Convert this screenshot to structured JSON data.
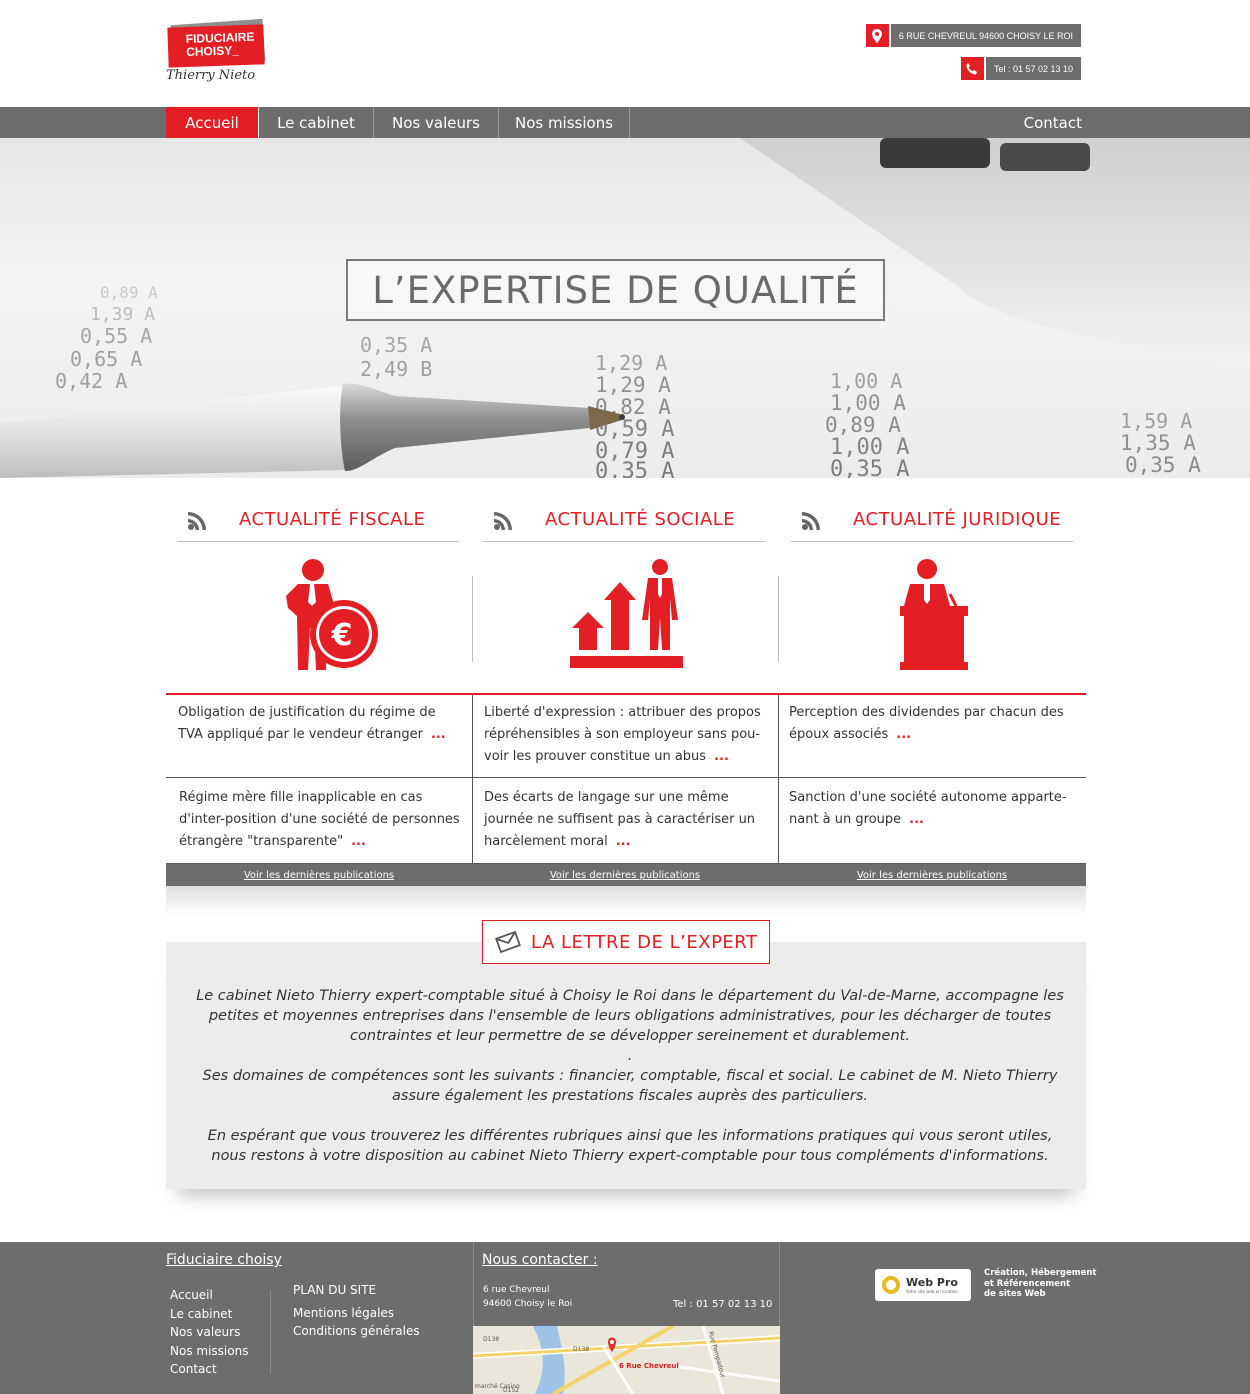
{
  "header": {
    "logo": {
      "line1": "FIDUCIAIRE",
      "line2": "CHOISY_",
      "signature": "Thierry Nieto"
    },
    "address": "6 RUE CHEVREUL 94600 CHOISY LE ROI",
    "phone": "Tel : 01 57 02 13 10"
  },
  "nav": {
    "items": [
      {
        "label": "Accueil",
        "active": true
      },
      {
        "label": "Le cabinet"
      },
      {
        "label": "Nos valeurs"
      },
      {
        "label": "Nos missions"
      }
    ],
    "contact": "Contact"
  },
  "hero": {
    "title": "L’EXPERTISE DE QUALITÉ",
    "numbers_left": [
      "0,55 A",
      "0,65 A",
      "0,42 A",
      "1,39 A",
      "0,89 A"
    ],
    "numbers_mid": [
      "2,49 B",
      "0,35 A",
      "1,29 A",
      "1,29 A",
      "0,82 A",
      "0,59 A",
      "0,79 A",
      "0,35 A"
    ],
    "numbers_right": [
      "1,00 A",
      "1,00 A",
      "0,89 A",
      "1,00 A",
      "0,35 A"
    ],
    "numbers_far": [
      "1,59 A",
      "1,35 A",
      "0,35 A"
    ]
  },
  "news": {
    "columns": [
      {
        "title": "ACTUALITÉ FISCALE",
        "items": [
          {
            "text": "Obligation de justification du régime de TVA appliqué par le vendeur étranger",
            "more": "..."
          },
          {
            "text": "Régime mère fille inapplicable en cas d'inter-position d'une société de personnes étrangère \"transparente\"",
            "more": "..."
          }
        ],
        "link": "Voir les dernières publications"
      },
      {
        "title": "ACTUALITÉ SOCIALE",
        "items": [
          {
            "text": "Liberté d'expression : attribuer des propos répréhensibles à son employeur sans pou-voir les prouver constitue un abus",
            "more": "..."
          },
          {
            "text": "Des écarts de langage sur une même journée ne suffisent pas à caractériser un harcèlement moral",
            "more": "..."
          }
        ],
        "link": "Voir les dernières publications"
      },
      {
        "title": "ACTUALITÉ JURIDIQUE",
        "items": [
          {
            "text": "Perception des dividendes par chacun des époux associés",
            "more": "..."
          },
          {
            "text": "Sanction d'une société autonome apparte-nant à un groupe",
            "more": "..."
          }
        ],
        "link": "Voir les dernières publications"
      }
    ]
  },
  "letter": {
    "title": "LA LETTRE DE L’EXPERT",
    "paragraphs": [
      "Le cabinet Nieto Thierry expert-comptable situé à Choisy le Roi dans le département du Val-de-Marne, accompagne les petites et moyennes entreprises dans l'ensemble de leurs obligations administratives, pour les décharger de toutes contraintes et leur permettre de se développer sereinement et durablement.",
      ".",
      "Ses domaines de compétences sont les suivants : financier, comptable, fiscal et social. Le cabinet de M. Nieto Thierry assure également les prestations fiscales auprès des particuliers.",
      "En espérant que vous trouverez les différentes rubriques ainsi que les informations pratiques qui vous seront utiles, nous restons à votre disposition au cabinet Nieto Thierry expert-comptable pour tous compléments d'informations."
    ]
  },
  "footer": {
    "title": "Fiduciaire choisy",
    "links": [
      "Accueil",
      "Le cabinet",
      "Nos valeurs",
      "Nos missions",
      "Contact"
    ],
    "links2": [
      "PLAN DU SITE",
      "Mentions légales",
      "Conditions générales"
    ],
    "contact_title": "Nous contacter :",
    "address_line1": "6 rue Chevreul",
    "address_line2": "94600 Choisy le Roi",
    "phone": "Tel : 01 57 02 13 10",
    "map": {
      "marker_label": "6 Rue Chevreul",
      "road_labels": [
        "D138",
        "D152",
        "D138"
      ],
      "street": "Rue Pompadour",
      "shop": "marché Casino"
    },
    "webipro": {
      "label": "Web Pro",
      "tagline": "Votre site web en location",
      "desc_line1": "Création, Hébergement",
      "desc_line2": "et Référencement",
      "desc_line3": "de sites Web"
    }
  },
  "colors": {
    "accent": "#e31e24",
    "bar": "#6d6d6d",
    "text": "#333333"
  }
}
